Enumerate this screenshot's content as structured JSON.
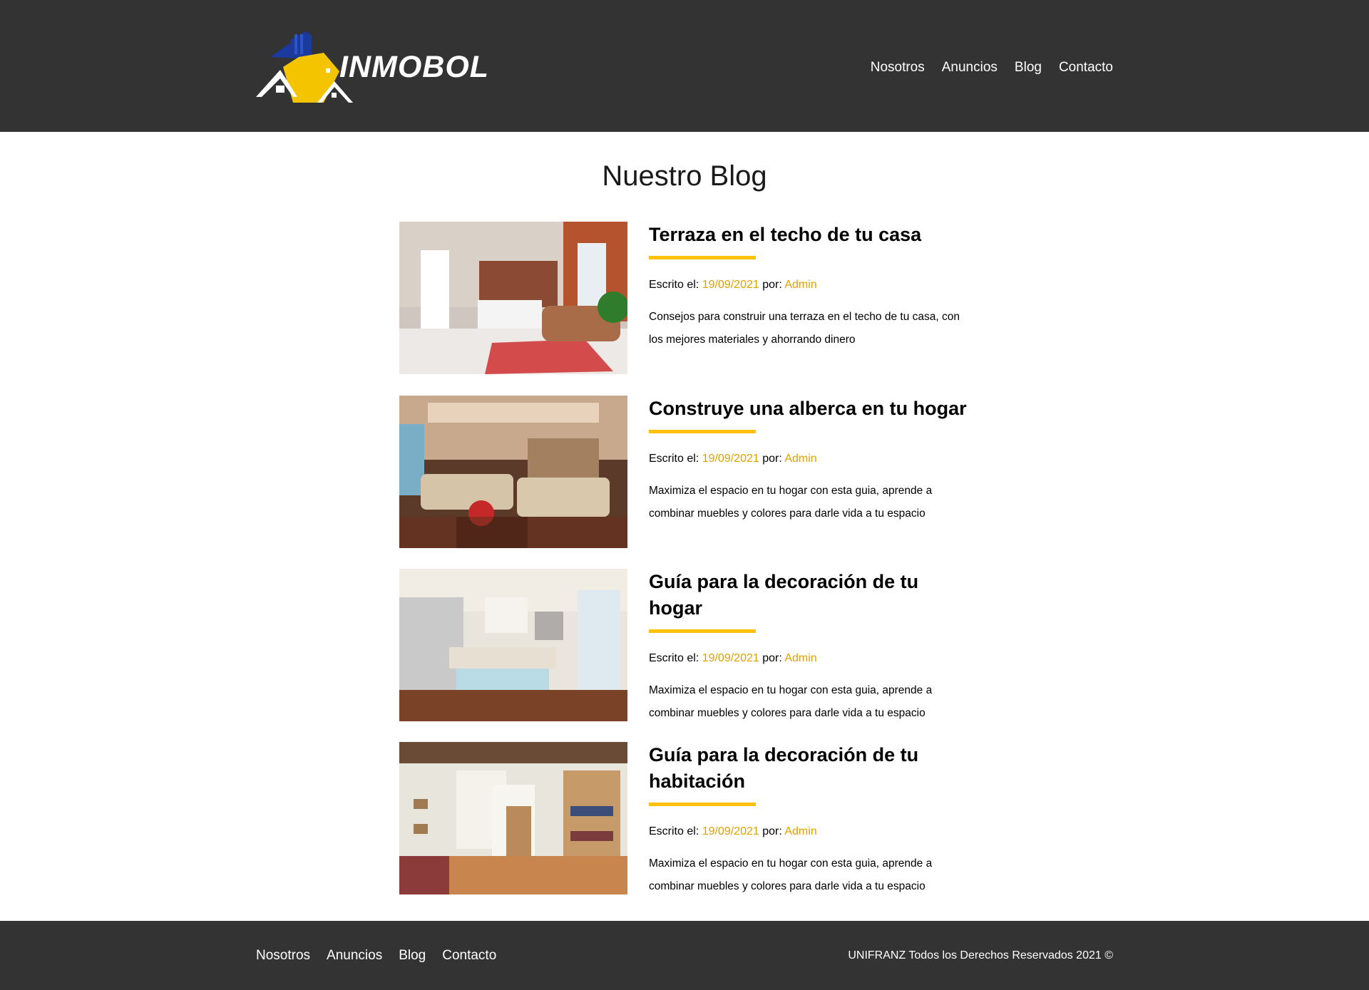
{
  "header": {
    "logo_text": "INMOBOL",
    "nav": [
      "Nosotros",
      "Anuncios",
      "Blog",
      "Contacto"
    ]
  },
  "page_title": "Nuestro Blog",
  "entries": [
    {
      "title": "Terraza en el techo de tu casa",
      "meta_label": "Escrito el: ",
      "date": "19/09/2021",
      "author_label": " por: ",
      "author": "Admin",
      "excerpt": "Consejos para construir una terraza en el techo de tu casa, con los mejores materiales y ahorrando dinero",
      "image": "living-room-photo"
    },
    {
      "title": "Construye una alberca en tu hogar",
      "meta_label": "Escrito el: ",
      "date": "19/09/2021",
      "author_label": " por: ",
      "author": "Admin",
      "excerpt": "Maximiza el espacio en tu hogar con esta guia, aprende a combinar muebles y colores para darle vida a tu espacio",
      "image": "lounge-photo"
    },
    {
      "title": "Guía para la decoración de tu hogar",
      "meta_label": "Escrito el: ",
      "date": "19/09/2021",
      "author_label": " por: ",
      "author": "Admin",
      "excerpt": "Maximiza el espacio en tu hogar con esta guia, aprende a combinar muebles y colores para darle vida a tu espacio",
      "image": "kitchen-photo"
    },
    {
      "title": "Guía para la decoración de tu habitación",
      "meta_label": "Escrito el: ",
      "date": "19/09/2021",
      "author_label": " por: ",
      "author": "Admin",
      "excerpt": "Maximiza el espacio en tu hogar con esta guia, aprende a combinar muebles y colores para darle vida a tu espacio",
      "image": "bookshelf-room-photo"
    }
  ],
  "footer": {
    "nav": [
      "Nosotros",
      "Anuncios",
      "Blog",
      "Contacto"
    ],
    "copyright": "UNIFRANZ Todos los Derechos Reservados 2021 ©"
  },
  "colors": {
    "header_bg": "#333333",
    "accent": "#ffc107",
    "meta_highlight": "#e0a100"
  }
}
